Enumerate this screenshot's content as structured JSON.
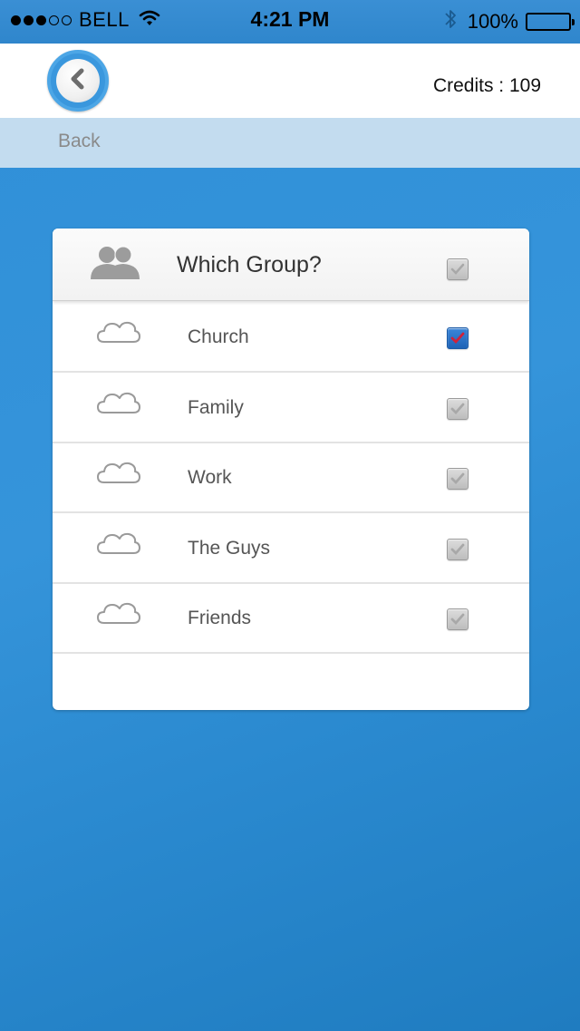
{
  "status_bar": {
    "carrier": "BELL",
    "time": "4:21 PM",
    "battery": "100%",
    "icons": [
      "signal-icon",
      "wifi-icon",
      "bluetooth-icon",
      "battery-icon"
    ]
  },
  "header": {
    "back_icon": "chevron-left-icon",
    "credits": "Credits : 109",
    "back_label": "Back"
  },
  "card": {
    "title": "Which Group?",
    "title_icon": "group-icon",
    "header_checked": false,
    "groups": [
      {
        "name": "Church",
        "icon": "cloud-icon",
        "checked": true
      },
      {
        "name": "Family",
        "icon": "cloud-icon",
        "checked": false
      },
      {
        "name": "Work",
        "icon": "cloud-icon",
        "checked": false
      },
      {
        "name": "The Guys",
        "icon": "cloud-icon",
        "checked": false
      },
      {
        "name": "Friends",
        "icon": "cloud-icon",
        "checked": false
      }
    ]
  },
  "colors": {
    "background": "#2f8fd8",
    "back_bar": "#c3dcef",
    "checked": "#2a72c8",
    "checkmark": "#d0223a"
  }
}
